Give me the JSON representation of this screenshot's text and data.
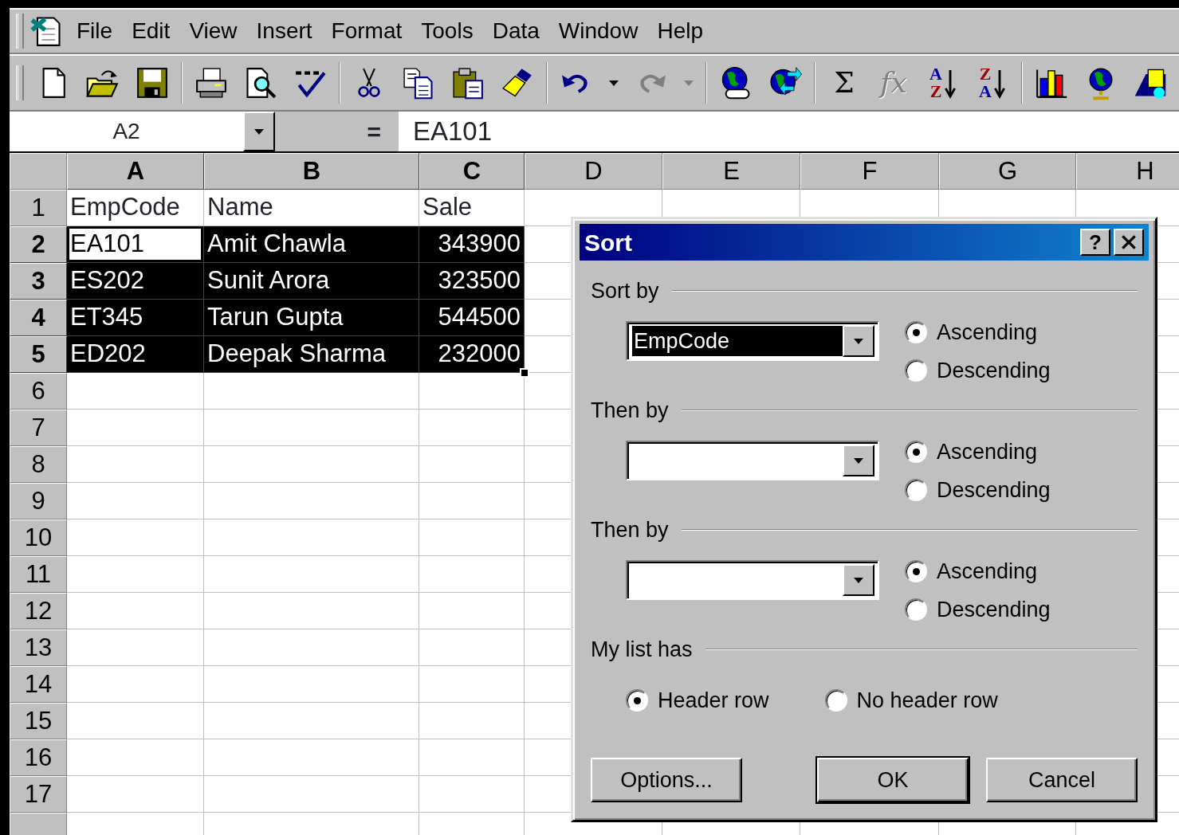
{
  "menu_bar": {
    "items": [
      "File",
      "Edit",
      "View",
      "Insert",
      "Format",
      "Tools",
      "Data",
      "Window",
      "Help"
    ]
  },
  "toolbar": [
    {
      "items": [
        {
          "kind": "new",
          "disabled": false
        },
        {
          "kind": "open",
          "disabled": false
        },
        {
          "kind": "save",
          "disabled": false
        }
      ]
    },
    {
      "items": [
        {
          "kind": "print",
          "disabled": false
        },
        {
          "kind": "print-preview",
          "disabled": false
        },
        {
          "kind": "spelling",
          "disabled": false
        }
      ]
    },
    {
      "items": [
        {
          "kind": "cut",
          "disabled": false
        },
        {
          "kind": "copy",
          "disabled": false
        },
        {
          "kind": "paste",
          "disabled": false
        },
        {
          "kind": "format-painter",
          "disabled": false
        }
      ]
    },
    {
      "items": [
        {
          "kind": "undo",
          "disabled": false
        },
        {
          "kind": "dropdown",
          "disabled": false
        },
        {
          "kind": "redo",
          "disabled": true
        },
        {
          "kind": "dropdown",
          "disabled": true
        }
      ]
    },
    {
      "items": [
        {
          "kind": "web-globe",
          "disabled": false
        },
        {
          "kind": "globe-arrows",
          "disabled": false
        }
      ]
    },
    {
      "items": [
        {
          "kind": "glyph",
          "glyph": "Σ",
          "disabled": false
        },
        {
          "kind": "glyph",
          "glyph": "fx",
          "disabled": true
        },
        {
          "kind": "sort",
          "disabled": false,
          "letters": [
            {
              "text": "A",
              "color": "#0000a0"
            },
            {
              "text": "Z",
              "color": "#a00000"
            }
          ]
        },
        {
          "kind": "sort",
          "disabled": false,
          "letters": [
            {
              "text": "Z",
              "color": "#a00000"
            },
            {
              "text": "A",
              "color": "#0000a0"
            }
          ]
        }
      ]
    },
    {
      "items": [
        {
          "kind": "chart",
          "disabled": false
        },
        {
          "kind": "map-globe",
          "disabled": false
        },
        {
          "kind": "drawing",
          "disabled": false
        }
      ]
    }
  ],
  "formula_bar": {
    "name_box": "A2",
    "equals": "=",
    "formula": "EA101"
  },
  "sheet": {
    "columns": [
      {
        "label": "A",
        "selected": true
      },
      {
        "label": "B",
        "selected": true
      },
      {
        "label": "C",
        "selected": true
      },
      {
        "label": "D",
        "selected": false
      },
      {
        "label": "E",
        "selected": false
      },
      {
        "label": "F",
        "selected": false
      },
      {
        "label": "G",
        "selected": false
      },
      {
        "label": "H",
        "selected": false
      }
    ],
    "rows": [
      {
        "label": "1",
        "selected": false,
        "cells": [
          {
            "text": "EmpCode",
            "kind": "text",
            "selected": false,
            "active": false
          },
          {
            "text": "Name",
            "kind": "text",
            "selected": false,
            "active": false
          },
          {
            "text": "Sale",
            "kind": "text",
            "selected": false,
            "active": false
          }
        ]
      },
      {
        "label": "2",
        "selected": true,
        "cells": [
          {
            "text": "EA101",
            "kind": "text",
            "selected": true,
            "active": true
          },
          {
            "text": "Amit Chawla",
            "kind": "text",
            "selected": true,
            "active": false
          },
          {
            "text": "343900",
            "kind": "number",
            "selected": true,
            "active": false
          }
        ]
      },
      {
        "label": "3",
        "selected": true,
        "cells": [
          {
            "text": "ES202",
            "kind": "text",
            "selected": true,
            "active": false
          },
          {
            "text": "Sunit Arora",
            "kind": "text",
            "selected": true,
            "active": false
          },
          {
            "text": "323500",
            "kind": "number",
            "selected": true,
            "active": false
          }
        ]
      },
      {
        "label": "4",
        "selected": true,
        "cells": [
          {
            "text": "ET345",
            "kind": "text",
            "selected": true,
            "active": false
          },
          {
            "text": "Tarun Gupta",
            "kind": "text",
            "selected": true,
            "active": false
          },
          {
            "text": "544500",
            "kind": "number",
            "selected": true,
            "active": false
          }
        ]
      },
      {
        "label": "5",
        "selected": true,
        "cells": [
          {
            "text": "ED202",
            "kind": "text",
            "selected": true,
            "active": false
          },
          {
            "text": "Deepak Sharma",
            "kind": "text",
            "selected": true,
            "active": false
          },
          {
            "text": "232000",
            "kind": "number",
            "selected": true,
            "active": false
          }
        ]
      },
      {
        "label": "6",
        "selected": false
      },
      {
        "label": "7",
        "selected": false
      },
      {
        "label": "8",
        "selected": false
      },
      {
        "label": "9",
        "selected": false
      },
      {
        "label": "10",
        "selected": false
      },
      {
        "label": "11",
        "selected": false
      },
      {
        "label": "12",
        "selected": false
      },
      {
        "label": "13",
        "selected": false
      },
      {
        "label": "14",
        "selected": false
      },
      {
        "label": "15",
        "selected": false
      },
      {
        "label": "16",
        "selected": false
      },
      {
        "label": "17",
        "selected": false
      },
      {
        "selected": false
      }
    ]
  },
  "dialog": {
    "title": "Sort",
    "help_button": "?",
    "sections": [
      {
        "kind": "sort-key",
        "label": "Sort by",
        "value": "EmpCode",
        "highlighted": true,
        "options": [
          {
            "label": "Ascending",
            "selected": true
          },
          {
            "label": "Descending",
            "selected": false
          }
        ]
      },
      {
        "kind": "sort-key",
        "label": "Then by",
        "options": [
          {
            "label": "Ascending",
            "selected": true
          },
          {
            "label": "Descending",
            "selected": false
          }
        ]
      },
      {
        "kind": "sort-key",
        "label": "Then by",
        "options": [
          {
            "label": "Ascending",
            "selected": true
          },
          {
            "label": "Descending",
            "selected": false
          }
        ]
      },
      {
        "kind": "header",
        "label": "My list has",
        "options": [
          {
            "label": "Header row",
            "selected": true
          },
          {
            "label": "No header row",
            "selected": false
          }
        ]
      }
    ],
    "buttons": [
      {
        "label": "Options...",
        "default": false
      },
      {
        "label": "OK",
        "default": true
      },
      {
        "label": "Cancel",
        "default": false
      }
    ]
  }
}
